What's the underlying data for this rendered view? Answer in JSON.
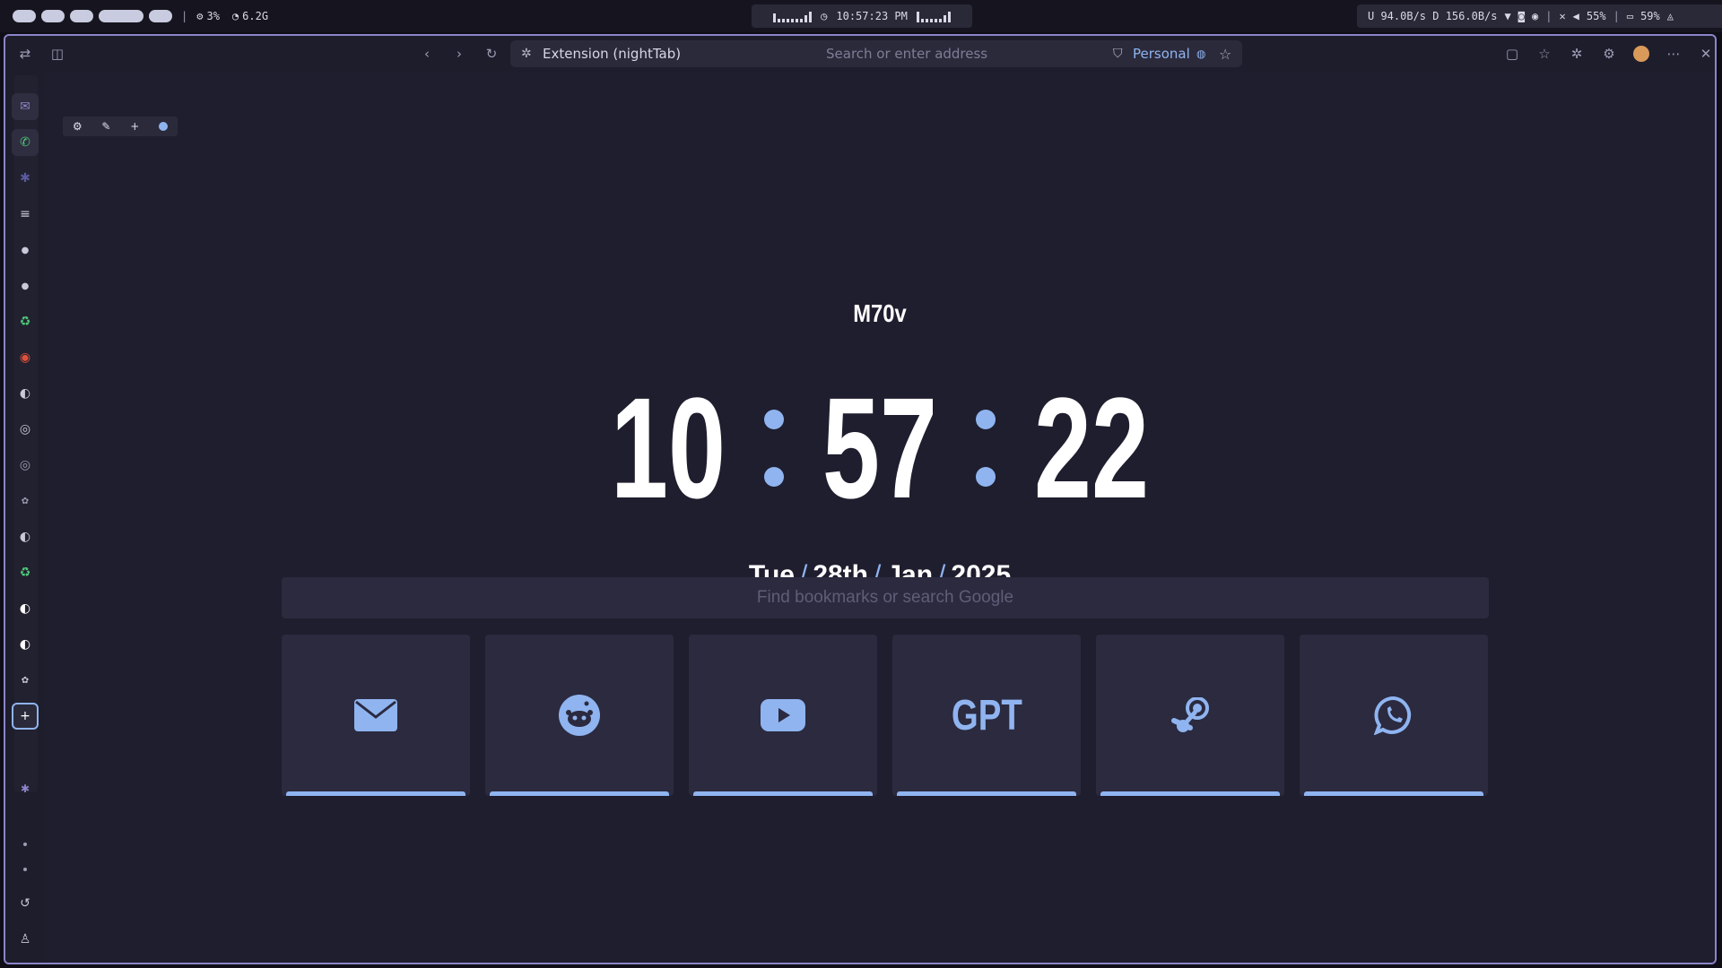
{
  "statusbar": {
    "cpu": "3%",
    "memory": "6.2G",
    "time": "10:57:23 PM",
    "network": "U 94.0B/s D 156.0B/s",
    "volume": "55%",
    "battery": "59%"
  },
  "browser": {
    "tab_label": "Extension (nightTab)",
    "address_placeholder": "Search or enter address",
    "profile": "Personal"
  },
  "page": {
    "greeting": "M70v",
    "clock": {
      "hours": "10",
      "minutes": "57",
      "seconds": "22"
    },
    "date": {
      "day": "Tue",
      "date": "28th",
      "month": "Jan",
      "year": "2025"
    },
    "search_placeholder": "Find bookmarks or search Google",
    "bookmarks": [
      {
        "name": "mail",
        "icon": "envelope-icon"
      },
      {
        "name": "reddit",
        "icon": "reddit-icon"
      },
      {
        "name": "youtube",
        "icon": "youtube-icon"
      },
      {
        "name": "gpt",
        "label": "GPT"
      },
      {
        "name": "steam",
        "icon": "steam-icon"
      },
      {
        "name": "whatsapp",
        "icon": "whatsapp-icon"
      }
    ]
  },
  "colors": {
    "accent": "#8fb4f0",
    "background": "#1f1e2e",
    "tile": "#2b2a3f",
    "frame_border": "#8b85c9"
  }
}
